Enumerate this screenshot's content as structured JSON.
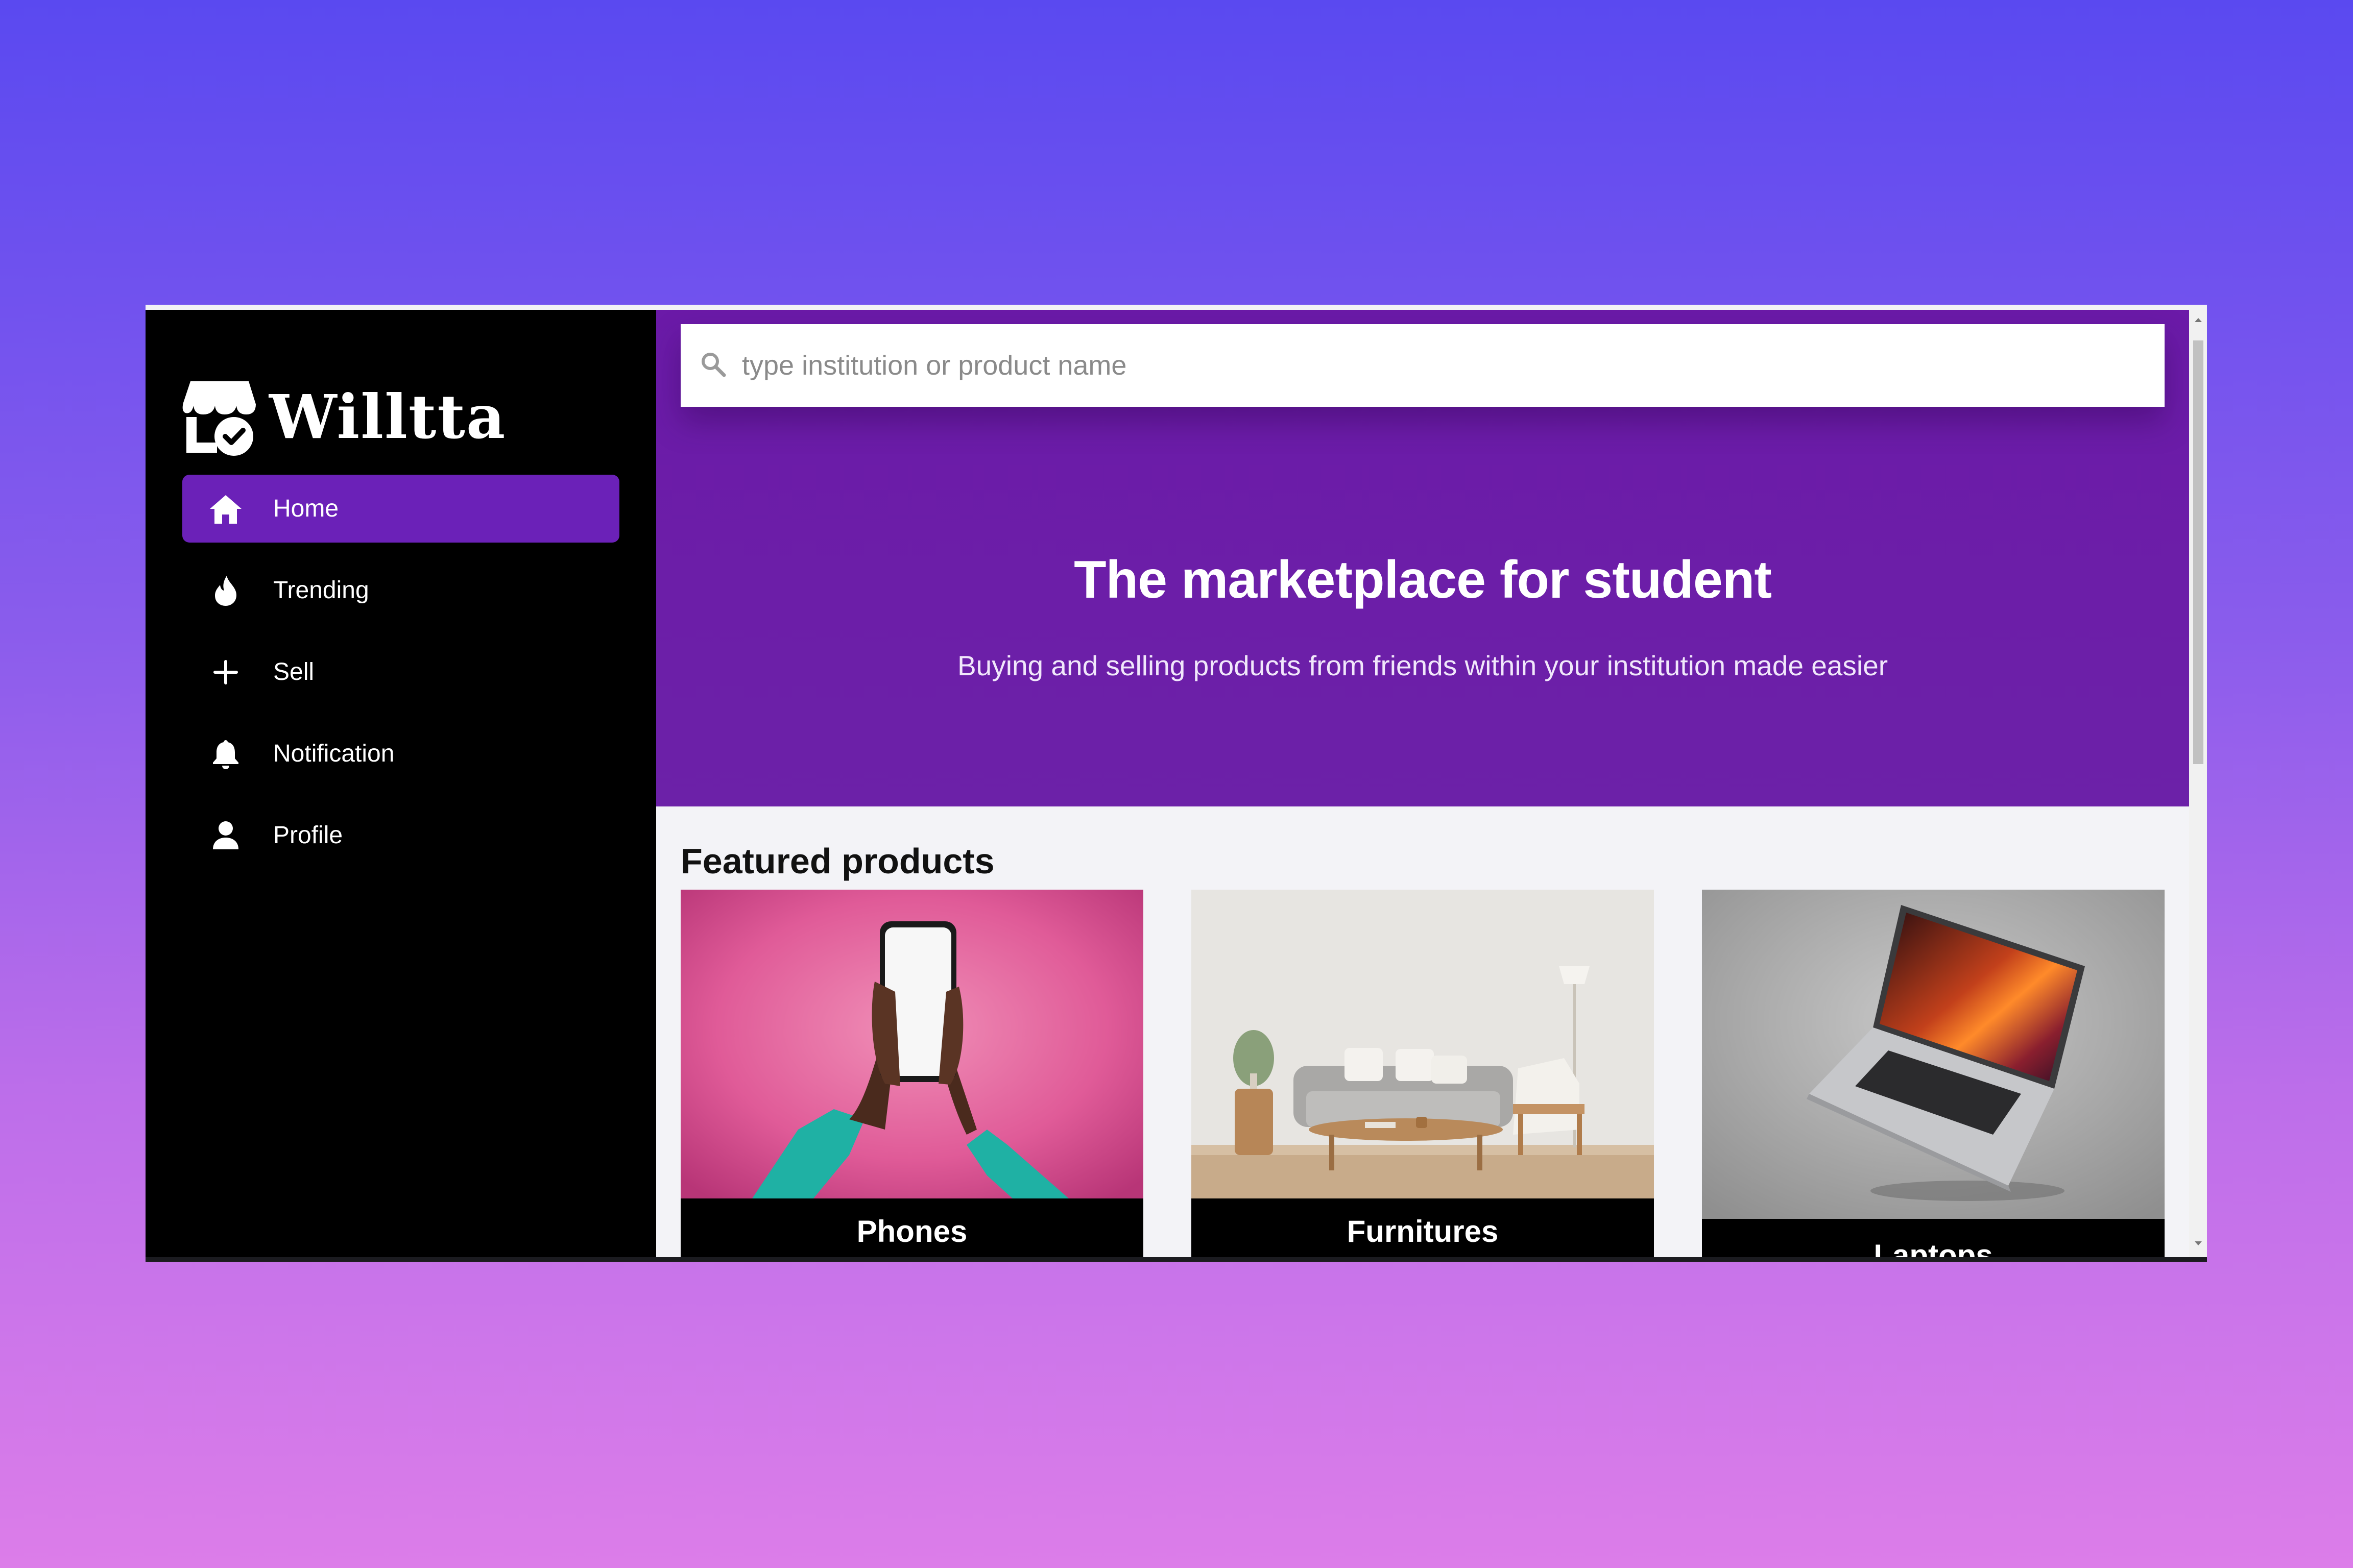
{
  "app": {
    "name": "Willtta"
  },
  "sidebar": {
    "items": [
      {
        "label": "Home",
        "icon": "home-icon",
        "active": true
      },
      {
        "label": "Trending",
        "icon": "flame-icon",
        "active": false
      },
      {
        "label": "Sell",
        "icon": "plus-icon",
        "active": false
      },
      {
        "label": "Notification",
        "icon": "bell-icon",
        "active": false
      },
      {
        "label": "Profile",
        "icon": "user-icon",
        "active": false
      }
    ]
  },
  "search": {
    "placeholder": "type institution or product name",
    "value": ""
  },
  "hero": {
    "title": "The marketplace for student",
    "subtitle": "Buying and selling products from friends within your institution made easier"
  },
  "featured": {
    "title": "Featured products",
    "products": [
      {
        "label": "Phones"
      },
      {
        "label": "Furnitures"
      },
      {
        "label": "Laptops"
      }
    ]
  },
  "colors": {
    "accent": "#6b21b8",
    "hero_bg": "#6b1ea8",
    "sidebar_bg": "#000000",
    "page_bg": "#f3f3f7"
  }
}
